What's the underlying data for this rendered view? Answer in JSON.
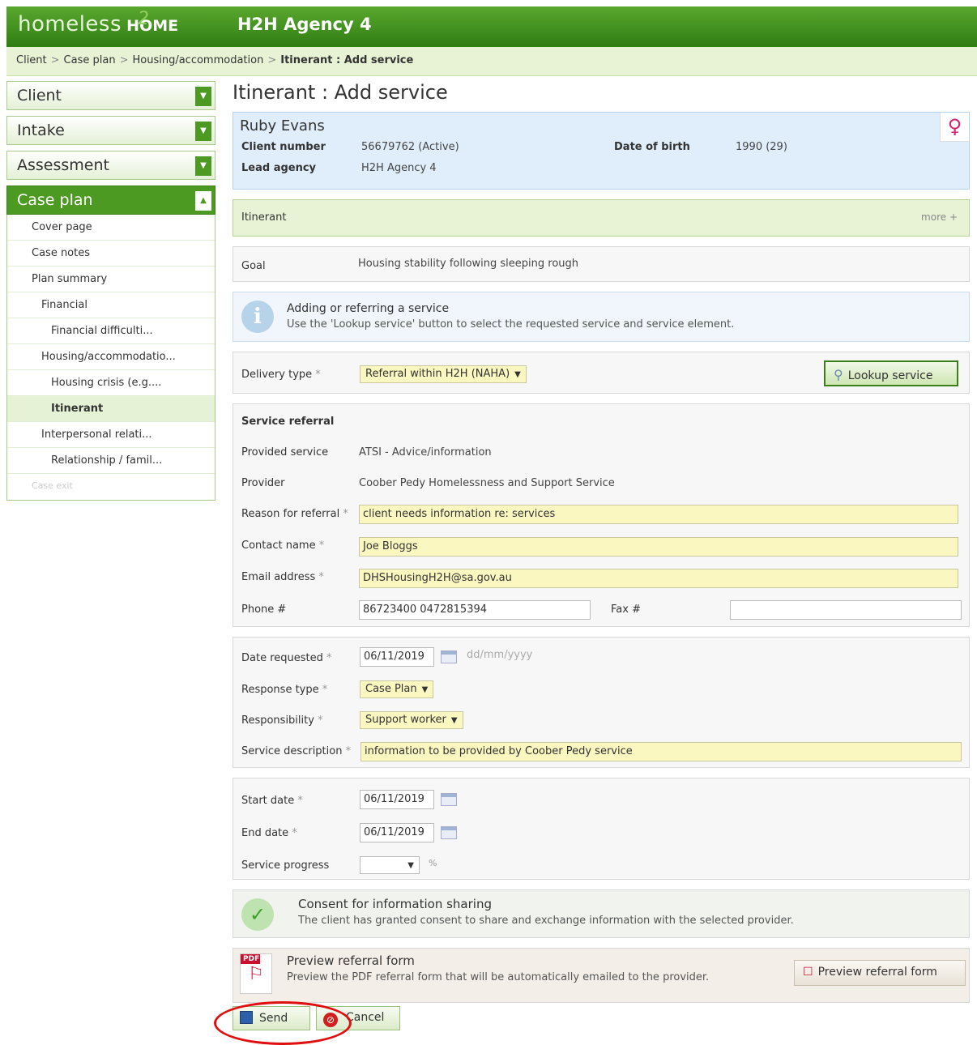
{
  "header": {
    "logo_part1": "homeless",
    "logo_part2": "HOME",
    "logo_mark": "2",
    "agency": "H2H Agency 4"
  },
  "breadcrumb": {
    "items": [
      "Client",
      "Case plan",
      "Housing/accommodation"
    ],
    "current": "Itinerant : Add service",
    "separator": ">"
  },
  "sidebar": {
    "sections": [
      {
        "label": "Client",
        "toggle": "▼"
      },
      {
        "label": "Intake",
        "toggle": "▼"
      },
      {
        "label": "Assessment",
        "toggle": "▼"
      }
    ],
    "active_section": {
      "label": "Case plan",
      "toggle": "▲"
    },
    "items": [
      {
        "label": "Cover page"
      },
      {
        "label": "Case notes"
      },
      {
        "label": "Plan summary"
      },
      {
        "label": "Financial"
      },
      {
        "label": "Financial difficulti..."
      },
      {
        "label": "Housing/accommodatio..."
      },
      {
        "label": "Housing crisis (e.g...."
      },
      {
        "label": "Itinerant"
      },
      {
        "label": "Interpersonal relati..."
      },
      {
        "label": "Relationship / famil..."
      },
      {
        "label": "Case exit"
      }
    ]
  },
  "page_title": "Itinerant : Add service",
  "client": {
    "name": "Ruby Evans",
    "gender_icon": "♀",
    "client_number_label": "Client number",
    "client_number": "56679762 (Active)",
    "dob_label": "Date of birth",
    "dob": "1990 (29)",
    "lead_agency_label": "Lead agency",
    "lead_agency": "H2H Agency 4"
  },
  "plan": {
    "title": "Itinerant",
    "more": "more +"
  },
  "goal": {
    "label": "Goal",
    "value": "Housing stability following sleeping rough"
  },
  "info": {
    "heading": "Adding or referring a service",
    "text": "Use the 'Lookup service' button to select the requested service and service element."
  },
  "delivery": {
    "label": "Delivery type",
    "value": "Referral within H2H (NAHA)",
    "lookup_button": "Lookup service"
  },
  "referral": {
    "heading": "Service referral",
    "provided_service_label": "Provided service",
    "provided_service": "ATSI - Advice/information",
    "provider_label": "Provider",
    "provider": "Coober Pedy Homelessness and Support Service",
    "reason_label": "Reason for referral",
    "reason": "client needs information re: services",
    "contact_label": "Contact name",
    "contact": "Joe Bloggs",
    "email_label": "Email address",
    "email": "DHSHousingH2H@sa.gov.au",
    "phone_label": "Phone #",
    "phone": "86723400  0472815394",
    "fax_label": "Fax #",
    "fax": ""
  },
  "request": {
    "date_label": "Date requested",
    "date": "06/11/2019",
    "date_hint": "dd/mm/yyyy",
    "response_label": "Response type",
    "response": "Case Plan",
    "responsibility_label": "Responsibility",
    "responsibility": "Support worker",
    "description_label": "Service description",
    "description": "information to be provided by Coober Pedy service"
  },
  "dates": {
    "start_label": "Start date",
    "start": "06/11/2019",
    "end_label": "End date",
    "end": "06/11/2019",
    "progress_label": "Service progress",
    "progress": "",
    "progress_unit": "%"
  },
  "consent": {
    "heading": "Consent for information sharing",
    "text": "The client has granted consent to share and exchange information with the selected provider."
  },
  "preview": {
    "heading": "Preview referral form",
    "text": "Preview the PDF referral form that will be automatically emailed to the provider.",
    "button": "Preview referral form",
    "pdf_label": "PDF"
  },
  "actions": {
    "send": "Send",
    "cancel": "Cancel"
  },
  "required_marker": "*",
  "colors": {
    "header_green": "#2f7d13",
    "field_yellow": "#fbf7c0",
    "client_panel": "#dfeefa",
    "highlight_red": "#e01010"
  }
}
